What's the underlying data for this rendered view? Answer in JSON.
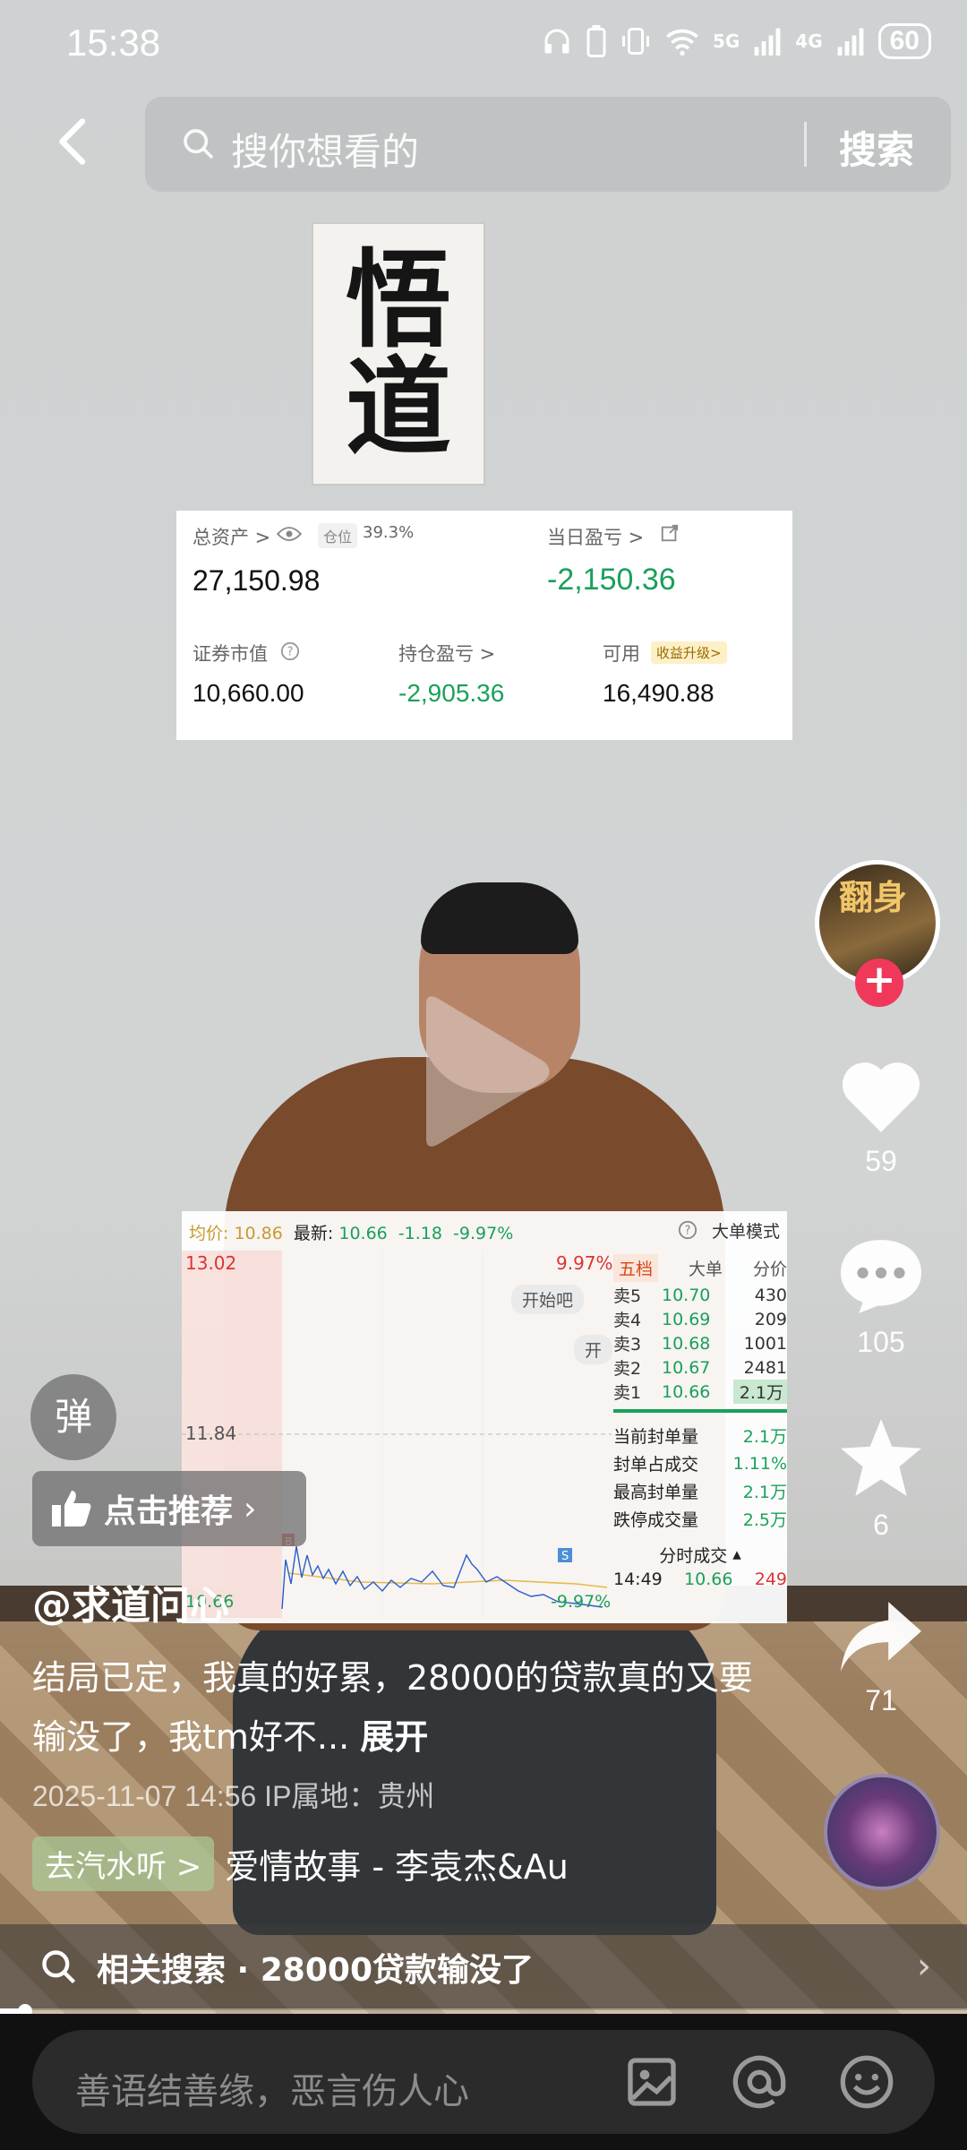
{
  "status": {
    "time": "15:38",
    "net1": "5G",
    "net2": "4G",
    "battery": "60"
  },
  "search": {
    "placeholder": "搜你想看的",
    "button": "搜索"
  },
  "poster": {
    "line1": "悟",
    "line2": "道"
  },
  "asset_card": {
    "total_label": "总资产 >",
    "position_tag": "仓位",
    "position_pct": "39.3%",
    "total_value": "27,150.98",
    "daily_label": "当日盈亏 >",
    "daily_value": "-2,150.36",
    "market_label": "证券市值",
    "market_value": "10,660.00",
    "hold_label": "持仓盈亏 >",
    "hold_value": "-2,905.36",
    "avail_label": "可用",
    "avail_tag": "收益升级>",
    "avail_value": "16,490.88"
  },
  "stock": {
    "avg_label": "均价:",
    "avg_value": "10.86",
    "latest_label": "最新:",
    "latest_value": "10.66",
    "change": "-1.18",
    "change_pct": "-9.97%",
    "mode": "大单模式",
    "price_high": "13.02",
    "pct_high": "9.97%",
    "price_mid": "11.84",
    "price_low": "10.66",
    "pct_low": "-9.97%",
    "pill1": "开始吧",
    "pill2": "开",
    "marker_b": "B",
    "marker_s": "S",
    "tabs": [
      "五档",
      "大单",
      "分价"
    ],
    "asks": [
      {
        "name": "卖5",
        "price": "10.70",
        "qty": "430"
      },
      {
        "name": "卖4",
        "price": "10.69",
        "qty": "209"
      },
      {
        "name": "卖3",
        "price": "10.68",
        "qty": "1001"
      },
      {
        "name": "卖2",
        "price": "10.67",
        "qty": "2481"
      },
      {
        "name": "卖1",
        "price": "10.66",
        "qty": "2.1万"
      }
    ],
    "stats": [
      {
        "label": "当前封单量",
        "value": "2.1万"
      },
      {
        "label": "封单占成交",
        "value": "1.11%"
      },
      {
        "label": "最高封单量",
        "value": "2.1万"
      },
      {
        "label": "跌停成交量",
        "value": "2.5万"
      }
    ],
    "trade_label": "分时成交",
    "trade_time": "14:49",
    "trade_price": "10.66",
    "trade_qty": "249"
  },
  "rail": {
    "avatar_text": "翻身",
    "likes": "59",
    "comments": "105",
    "favorites": "6",
    "shares": "71"
  },
  "danmaku": "弹",
  "recommend": "点击推荐",
  "author": "@求道问心",
  "caption": "结局已定，我真的好累，28000的贷款真的又要输没了，我tm好不...",
  "caption_more": "展开",
  "meta": "2025-11-07 14:56  IP属地：贵州",
  "music": {
    "chip": "去汽水听 >",
    "title": "爱情故事 - 李袁杰&Au"
  },
  "related": {
    "label": "相关搜索 · 28000贷款输没了"
  },
  "progress": {
    "fraction": 0.02
  },
  "comment": {
    "placeholder": "善语结善缘，恶言伤人心"
  }
}
